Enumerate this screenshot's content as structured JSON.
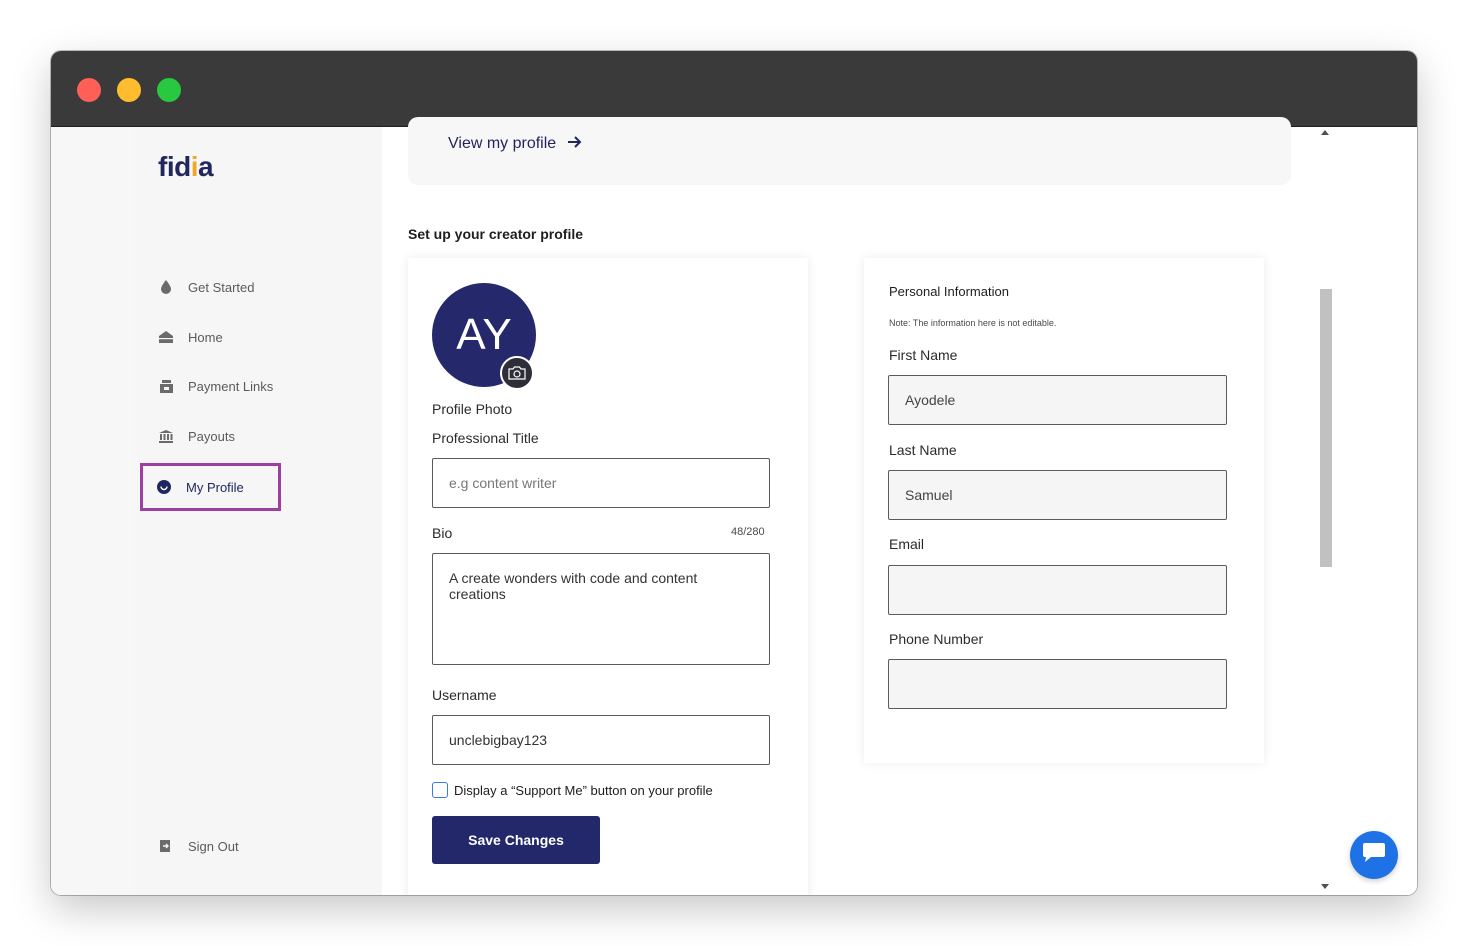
{
  "colors": {
    "brand_navy": "#22265f",
    "active_outline": "#9c3fa0",
    "chat_blue": "#1f72e6",
    "logo_accent": "#f0a824"
  },
  "sidebar": {
    "logo": {
      "text_before": "fid",
      "text_accent": "i",
      "text_after": "a"
    },
    "items": [
      {
        "label": "Get Started",
        "icon": "drop-icon"
      },
      {
        "label": "Home",
        "icon": "home-icon"
      },
      {
        "label": "Payment Links",
        "icon": "store-icon"
      },
      {
        "label": "Payouts",
        "icon": "bank-icon"
      },
      {
        "label": "My Profile",
        "icon": "profile-icon",
        "active": true
      }
    ],
    "sign_out": {
      "label": "Sign Out",
      "icon": "sign-out-icon"
    }
  },
  "main": {
    "view_profile_link": "View my profile",
    "section_title": "Set up your creator profile",
    "profile_card": {
      "avatar_initials": "AY",
      "profile_photo_label": "Profile Photo",
      "professional_title_label": "Professional Title",
      "professional_title_placeholder": "e.g content writer",
      "bio_label": "Bio",
      "bio_counter": "48/280",
      "bio_value": "A create wonders with code and content creations",
      "username_label": "Username",
      "username_value": "unclebigbay123",
      "support_checkbox_label": "Display a “Support Me” button on your profile",
      "support_checked": false,
      "save_button": "Save Changes"
    },
    "personal_card": {
      "title": "Personal Information",
      "note": "Note: The information here is not editable.",
      "first_name_label": "First Name",
      "first_name_value": "Ayodele",
      "last_name_label": "Last Name",
      "last_name_value": "Samuel",
      "email_label": "Email",
      "email_value": "",
      "phone_label": "Phone Number",
      "phone_value": ""
    }
  }
}
